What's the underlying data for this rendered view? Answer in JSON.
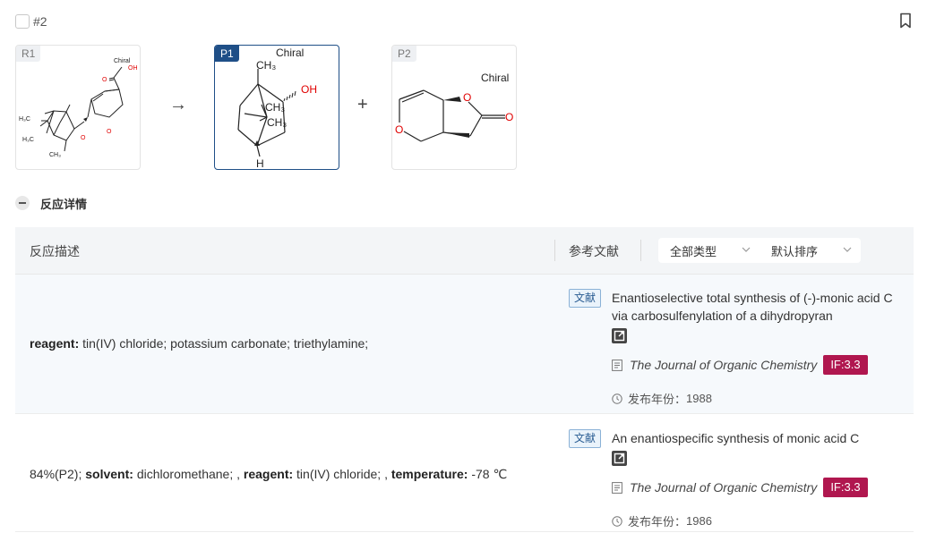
{
  "reaction": {
    "id": "#2"
  },
  "scheme": {
    "arrow": "→",
    "plus": "+",
    "molecules": [
      {
        "tag": "R1",
        "labels": [
          "Chiral",
          "OH",
          "O",
          "O",
          "O",
          "H₃C",
          "H₃C",
          "CH₃"
        ]
      },
      {
        "tag": "P1",
        "labels": [
          "Chiral",
          "CH₃",
          "OH",
          "CH₃",
          "CH₃",
          "H"
        ]
      },
      {
        "tag": "P2",
        "labels": [
          "Chiral",
          "O",
          "O",
          "O"
        ]
      }
    ]
  },
  "details": {
    "title": "反应详情"
  },
  "table": {
    "header": {
      "desc": "反应描述",
      "refs": "参考文献",
      "type_select": "全部类型",
      "sort_select": "默认排序"
    },
    "rows": [
      {
        "desc": [
          {
            "k": "reagent:",
            "v": " tin(IV) chloride; potassium carbonate; triethylamine;"
          }
        ],
        "ref": {
          "tag": "文献",
          "title": "Enantioselective total synthesis of (-)-monic acid C via carbosulfenylation of a dihydropyran",
          "journal": "The Journal of Organic Chemistry",
          "if": "IF:3.3",
          "year_label": "发布年份：",
          "year": "1988"
        }
      },
      {
        "desc_prefix": "84%(P2); ",
        "desc": [
          {
            "k": "solvent:",
            "v": " dichloromethane; , "
          },
          {
            "k": "reagent:",
            "v": " tin(IV) chloride; , "
          },
          {
            "k": "temperature:",
            "v": " -78 ℃"
          }
        ],
        "ref": {
          "tag": "文献",
          "title": "An enantiospecific synthesis of monic acid C",
          "journal": "The Journal of Organic Chemistry",
          "if": "IF:3.3",
          "year_label": "发布年份：",
          "year": "1986"
        }
      }
    ]
  },
  "colors": {
    "accent": "#1f4f87",
    "if_badge": "#b0174f",
    "oxygen": "#e00000",
    "tag_border": "#8ab1d6"
  }
}
